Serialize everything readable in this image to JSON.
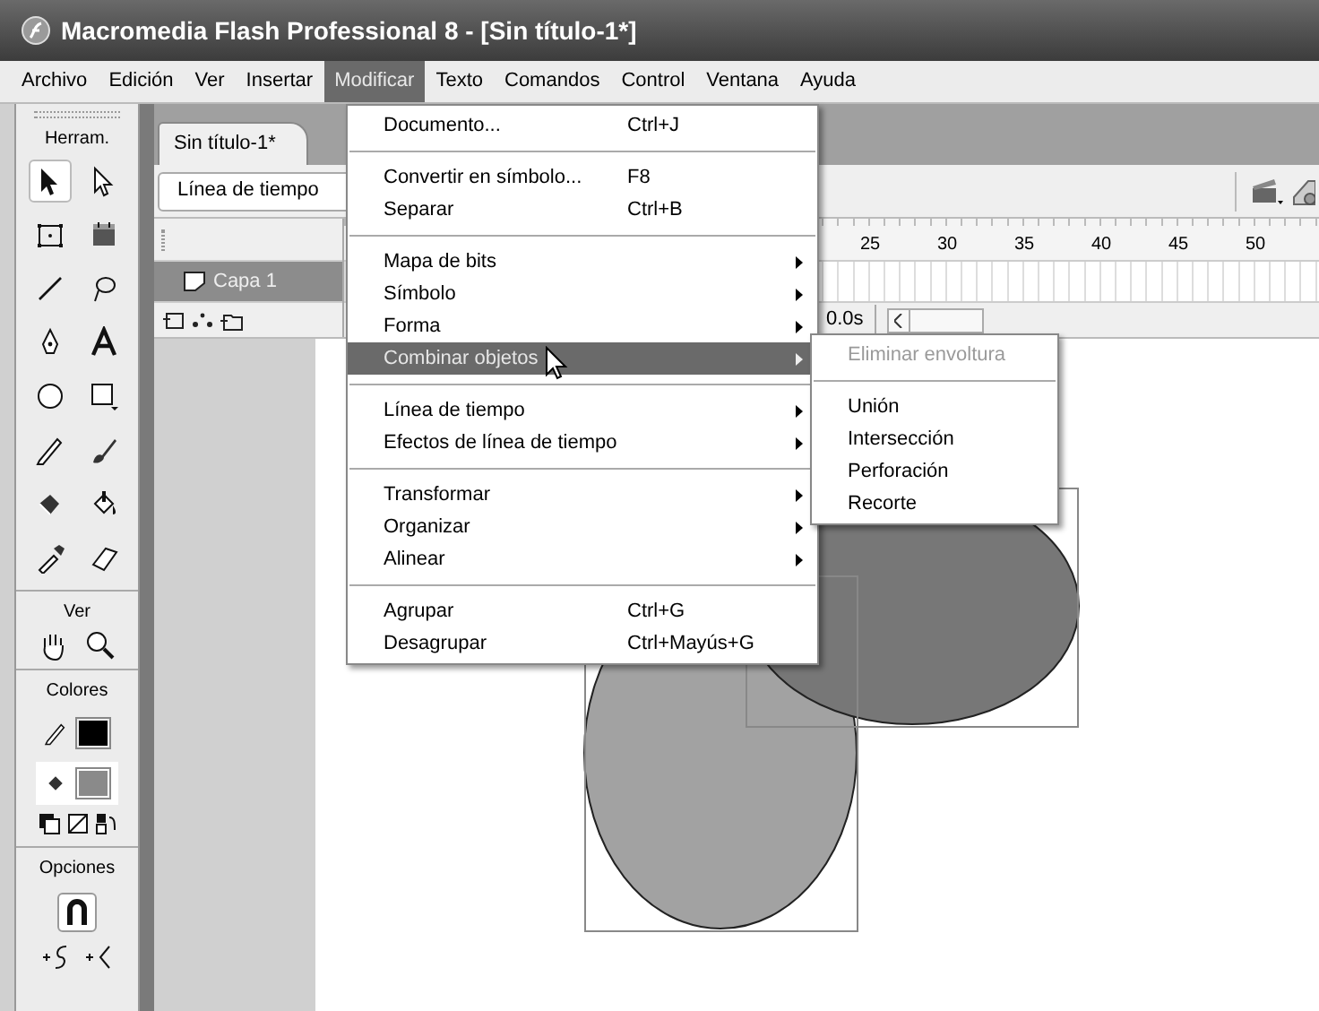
{
  "window": {
    "title": "Macromedia Flash Professional 8 - [Sin título-1*]"
  },
  "menubar": [
    {
      "label": "Archivo",
      "selected": false
    },
    {
      "label": "Edición",
      "selected": false
    },
    {
      "label": "Ver",
      "selected": false
    },
    {
      "label": "Insertar",
      "selected": false
    },
    {
      "label": "Modificar",
      "selected": true
    },
    {
      "label": "Texto",
      "selected": false
    },
    {
      "label": "Comandos",
      "selected": false
    },
    {
      "label": "Control",
      "selected": false
    },
    {
      "label": "Ventana",
      "selected": false
    },
    {
      "label": "Ayuda",
      "selected": false
    }
  ],
  "toolbox": {
    "title": "Herram.",
    "tools": [
      {
        "selected": true
      },
      {
        "selected": false
      },
      {
        "selected": false
      },
      {
        "selected": false
      },
      {
        "selected": false
      },
      {
        "selected": false
      },
      {
        "selected": false
      },
      {
        "selected": false
      },
      {
        "selected": false
      },
      {
        "selected": false
      },
      {
        "selected": false
      },
      {
        "selected": false
      },
      {
        "selected": false
      },
      {
        "selected": false
      },
      {
        "selected": false
      },
      {
        "selected": false
      }
    ],
    "view_title": "Ver",
    "colors_title": "Colores",
    "swatches": [
      {
        "color": "#000000",
        "selected": false
      },
      {
        "color": "#8a8a8a",
        "selected": true
      }
    ],
    "options_title": "Opciones"
  },
  "document": {
    "tab": "Sin título-1*",
    "timeline_button": "Línea de tiempo",
    "ruler": [
      "25",
      "30",
      "35",
      "40",
      "45",
      "50"
    ],
    "layer": {
      "name": "Capa 1",
      "selected": true
    },
    "time": "0.0s"
  },
  "menu": [
    {
      "kind": "item",
      "label": "Documento...",
      "shortcut": "Ctrl+J",
      "submenu": false,
      "selected": false
    },
    {
      "kind": "separator"
    },
    {
      "kind": "item",
      "label": "Convertir en símbolo...",
      "shortcut": "F8",
      "submenu": false,
      "selected": false
    },
    {
      "kind": "item",
      "label": "Separar",
      "shortcut": "Ctrl+B",
      "submenu": false,
      "selected": false
    },
    {
      "kind": "separator"
    },
    {
      "kind": "item",
      "label": "Mapa de bits",
      "submenu": true,
      "selected": false
    },
    {
      "kind": "item",
      "label": "Símbolo",
      "submenu": true,
      "selected": false
    },
    {
      "kind": "item",
      "label": "Forma",
      "submenu": true,
      "selected": false
    },
    {
      "kind": "item",
      "label": "Combinar objetos",
      "submenu": true,
      "selected": true
    },
    {
      "kind": "separator"
    },
    {
      "kind": "item",
      "label": "Línea de tiempo",
      "submenu": true,
      "selected": false
    },
    {
      "kind": "item",
      "label": "Efectos de línea de tiempo",
      "submenu": true,
      "selected": false
    },
    {
      "kind": "separator"
    },
    {
      "kind": "item",
      "label": "Transformar",
      "submenu": true,
      "selected": false
    },
    {
      "kind": "item",
      "label": "Organizar",
      "submenu": true,
      "selected": false
    },
    {
      "kind": "item",
      "label": "Alinear",
      "submenu": true,
      "selected": false
    },
    {
      "kind": "separator"
    },
    {
      "kind": "item",
      "label": "Agrupar",
      "shortcut": "Ctrl+G",
      "submenu": false,
      "selected": false
    },
    {
      "kind": "item",
      "label": "Desagrupar",
      "shortcut": "Ctrl+Mayús+G",
      "submenu": false,
      "selected": false
    }
  ],
  "submenu": [
    {
      "kind": "item",
      "label": "Eliminar envoltura",
      "disabled": true
    },
    {
      "kind": "separator"
    },
    {
      "kind": "item",
      "label": "Unión",
      "disabled": false
    },
    {
      "kind": "item",
      "label": "Intersección",
      "disabled": false
    },
    {
      "kind": "item",
      "label": "Perforación",
      "disabled": false
    },
    {
      "kind": "item",
      "label": "Recorte",
      "disabled": false
    }
  ]
}
